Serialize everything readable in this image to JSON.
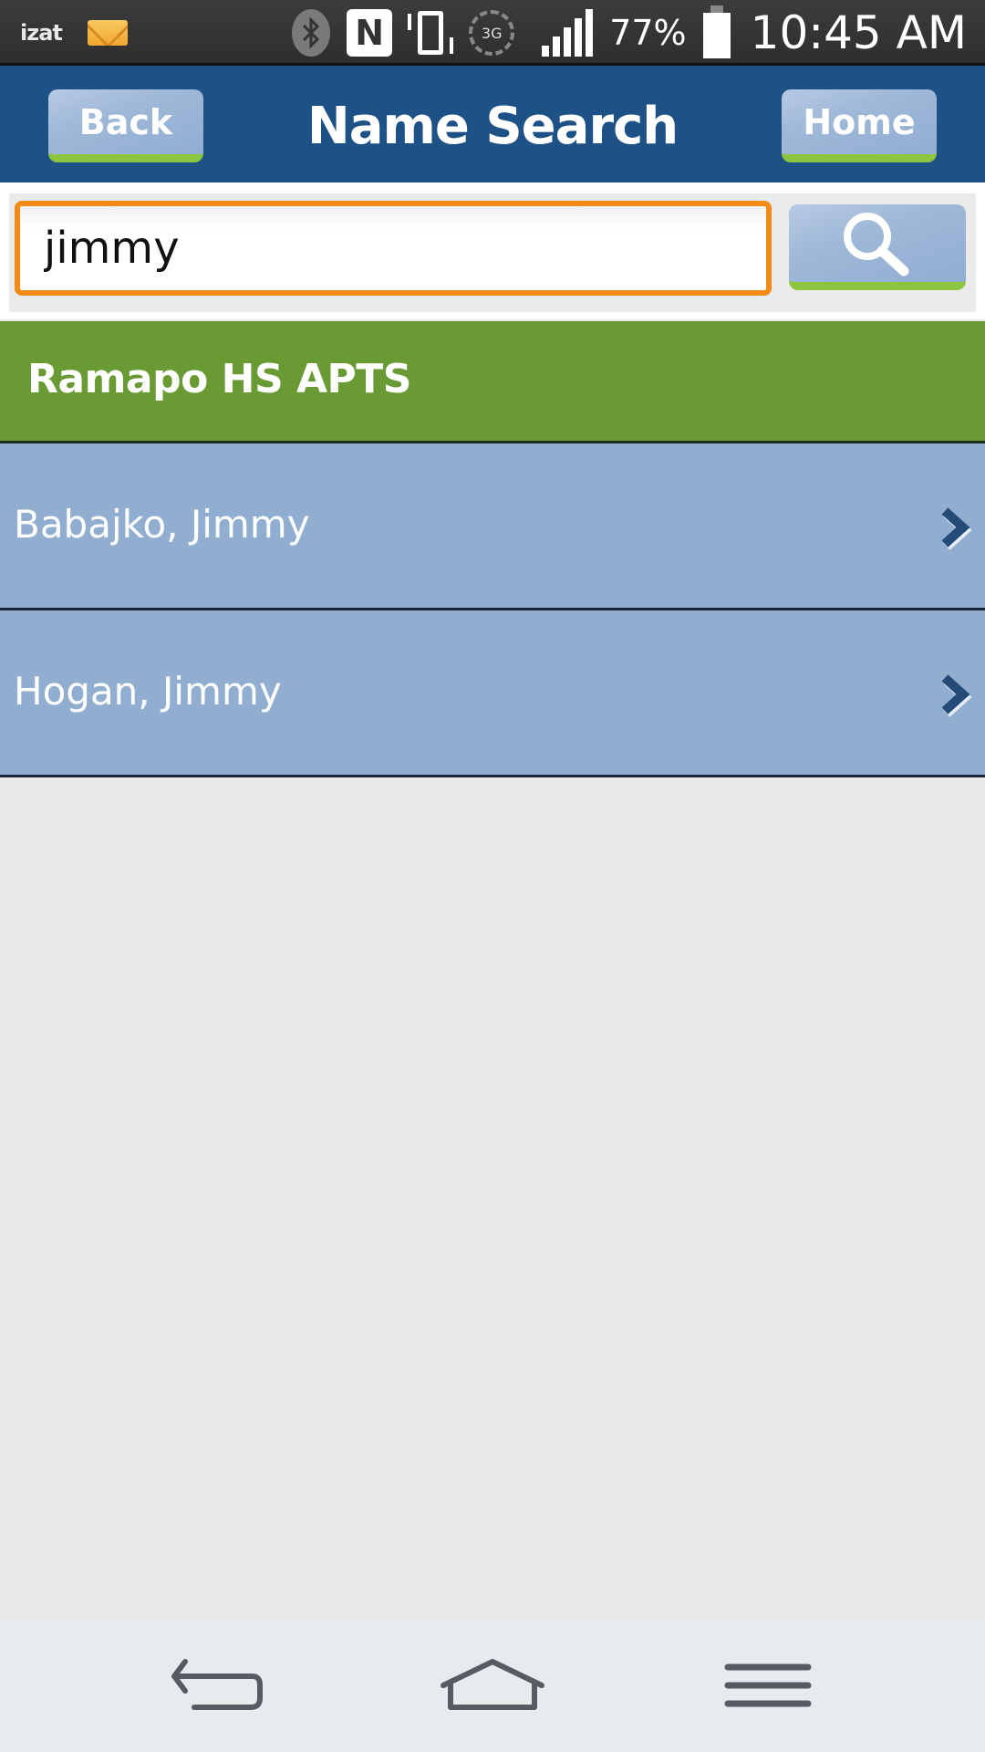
{
  "status_bar": {
    "app_icon": "izat-icon",
    "app_label": "izat",
    "notification_icon": "mail-icon",
    "bluetooth_icon": "bluetooth-icon",
    "nfc_label": "N",
    "vibrate_icon": "vibrate-icon",
    "network_label": "3G",
    "signal_icon": "signal-icon",
    "battery_percent": "77%",
    "battery_level": 0.77,
    "time": "10:45 AM"
  },
  "header": {
    "title": "Name Search",
    "back_label": "Back",
    "home_label": "Home"
  },
  "search": {
    "value": "jimmy",
    "placeholder": "",
    "button_icon": "search-icon"
  },
  "results": {
    "group_title": "Ramapo HS APTS",
    "items": [
      {
        "name": "Babajko, Jimmy"
      },
      {
        "name": "Hogan, Jimmy"
      }
    ]
  },
  "nav_bar": {
    "back_icon": "back-arrow-icon",
    "home_icon": "home-icon",
    "menu_icon": "menu-icon"
  },
  "colors": {
    "header_bg": "#1e5287",
    "button_accent": "#8cc63f",
    "search_border": "#f28a1a",
    "group_header_bg": "#6a9a33",
    "result_row_bg": "#91aed0",
    "page_bg": "#e9e9e9"
  }
}
